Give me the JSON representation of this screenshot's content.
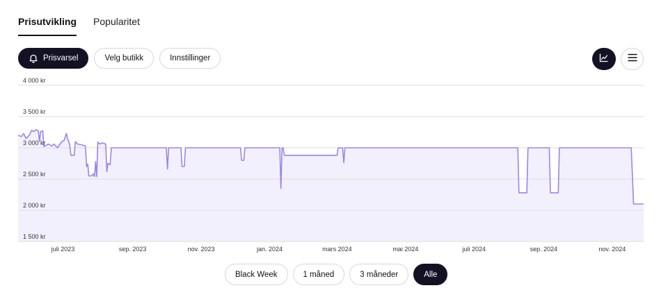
{
  "tabs": [
    {
      "label": "Prisutvikling",
      "active": true
    },
    {
      "label": "Popularitet",
      "active": false
    }
  ],
  "toolbar": {
    "alert_label": "Prisvarsel",
    "alert_icon": "bell-icon",
    "store_label": "Velg butikk",
    "settings_label": "Innstillinger"
  },
  "view_toggle": {
    "chart_icon": "line-chart-icon",
    "list_icon": "menu-lines-icon",
    "selected": "chart"
  },
  "colors": {
    "accent": "#131225",
    "series_line": "#9b86e6",
    "series_fill": "#f3f0fd",
    "grid": "#dcdce0"
  },
  "chart_data": {
    "type": "area",
    "title": "",
    "xlabel": "",
    "ylabel": "",
    "ylim": [
      1500,
      4000
    ],
    "y_ticks": [
      {
        "value": 4000,
        "label": "4 000 kr"
      },
      {
        "value": 3500,
        "label": "3 500 kr"
      },
      {
        "value": 3000,
        "label": "3 000 kr"
      },
      {
        "value": 2500,
        "label": "2 500 kr"
      },
      {
        "value": 2000,
        "label": "2 000 kr"
      },
      {
        "value": 1500,
        "label": "1 500 kr"
      }
    ],
    "xlim": [
      "2023-05-22",
      "2024-11-29"
    ],
    "x_ticks": [
      {
        "date": "2023-07-01",
        "label": "juli 2023"
      },
      {
        "date": "2023-09-01",
        "label": "sep. 2023"
      },
      {
        "date": "2023-11-01",
        "label": "nov. 2023"
      },
      {
        "date": "2024-01-01",
        "label": "jan. 2024"
      },
      {
        "date": "2024-03-01",
        "label": "mars 2024"
      },
      {
        "date": "2024-05-01",
        "label": "mai 2024"
      },
      {
        "date": "2024-07-01",
        "label": "juli 2024"
      },
      {
        "date": "2024-09-01",
        "label": "sep. 2024"
      },
      {
        "date": "2024-11-01",
        "label": "nov. 2024"
      }
    ],
    "grid": true,
    "legend": "none",
    "series": [
      {
        "points": [
          [
            "2023-05-22",
            3200
          ],
          [
            "2023-05-25",
            3180
          ],
          [
            "2023-05-27",
            3230
          ],
          [
            "2023-05-29",
            3150
          ],
          [
            "2023-06-01",
            3200
          ],
          [
            "2023-06-03",
            3280
          ],
          [
            "2023-06-05",
            3260
          ],
          [
            "2023-06-07",
            3290
          ],
          [
            "2023-06-09",
            3270
          ],
          [
            "2023-06-10",
            3100
          ],
          [
            "2023-06-11",
            3260
          ],
          [
            "2023-06-13",
            3270
          ],
          [
            "2023-06-14",
            3020
          ],
          [
            "2023-06-16",
            3040
          ],
          [
            "2023-06-18",
            3060
          ],
          [
            "2023-06-21",
            3030
          ],
          [
            "2023-06-23",
            3060
          ],
          [
            "2023-06-26",
            3000
          ],
          [
            "2023-06-28",
            3050
          ],
          [
            "2023-06-30",
            3100
          ],
          [
            "2023-07-02",
            3120
          ],
          [
            "2023-07-04",
            3230
          ],
          [
            "2023-07-05",
            3150
          ],
          [
            "2023-07-07",
            3050
          ],
          [
            "2023-07-08",
            2880
          ],
          [
            "2023-07-11",
            2880
          ],
          [
            "2023-07-12",
            3100
          ],
          [
            "2023-07-14",
            3060
          ],
          [
            "2023-07-17",
            3050
          ],
          [
            "2023-07-21",
            3030
          ],
          [
            "2023-07-22",
            2700
          ],
          [
            "2023-07-23",
            2740
          ],
          [
            "2023-07-24",
            2550
          ],
          [
            "2023-07-26",
            2550
          ],
          [
            "2023-07-28",
            2580
          ],
          [
            "2023-07-29",
            2540
          ],
          [
            "2023-07-30",
            2780
          ],
          [
            "2023-07-31",
            2540
          ],
          [
            "2023-08-01",
            3090
          ],
          [
            "2023-08-03",
            3060
          ],
          [
            "2023-08-05",
            3080
          ],
          [
            "2023-08-08",
            3060
          ],
          [
            "2023-08-09",
            2620
          ],
          [
            "2023-08-10",
            2750
          ],
          [
            "2023-08-12",
            2730
          ],
          [
            "2023-08-13",
            3000
          ],
          [
            "2023-10-01",
            3000
          ],
          [
            "2023-10-02",
            2660
          ],
          [
            "2023-10-03",
            3000
          ],
          [
            "2023-10-14",
            3000
          ],
          [
            "2023-10-15",
            2700
          ],
          [
            "2023-10-17",
            2700
          ],
          [
            "2023-10-18",
            3000
          ],
          [
            "2023-12-06",
            3000
          ],
          [
            "2023-12-07",
            2800
          ],
          [
            "2023-12-09",
            2800
          ],
          [
            "2023-12-10",
            3000
          ],
          [
            "2024-01-10",
            3000
          ],
          [
            "2024-01-11",
            2350
          ],
          [
            "2024-01-12",
            3000
          ],
          [
            "2024-01-13",
            3000
          ],
          [
            "2024-01-14",
            2880
          ],
          [
            "2024-03-01",
            2880
          ],
          [
            "2024-03-02",
            3000
          ],
          [
            "2024-03-06",
            3000
          ],
          [
            "2024-03-07",
            2760
          ],
          [
            "2024-03-08",
            3000
          ],
          [
            "2024-08-09",
            3000
          ],
          [
            "2024-08-10",
            2280
          ],
          [
            "2024-08-17",
            2280
          ],
          [
            "2024-08-18",
            3000
          ],
          [
            "2024-09-06",
            3000
          ],
          [
            "2024-09-07",
            2280
          ],
          [
            "2024-09-14",
            2280
          ],
          [
            "2024-09-15",
            3000
          ],
          [
            "2024-11-18",
            3000
          ],
          [
            "2024-11-20",
            2100
          ],
          [
            "2024-11-29",
            2100
          ]
        ]
      }
    ]
  },
  "ranges": [
    {
      "label": "Black Week",
      "selected": false
    },
    {
      "label": "1 måned",
      "selected": false
    },
    {
      "label": "3 måneder",
      "selected": false
    },
    {
      "label": "Alle",
      "selected": true
    }
  ]
}
